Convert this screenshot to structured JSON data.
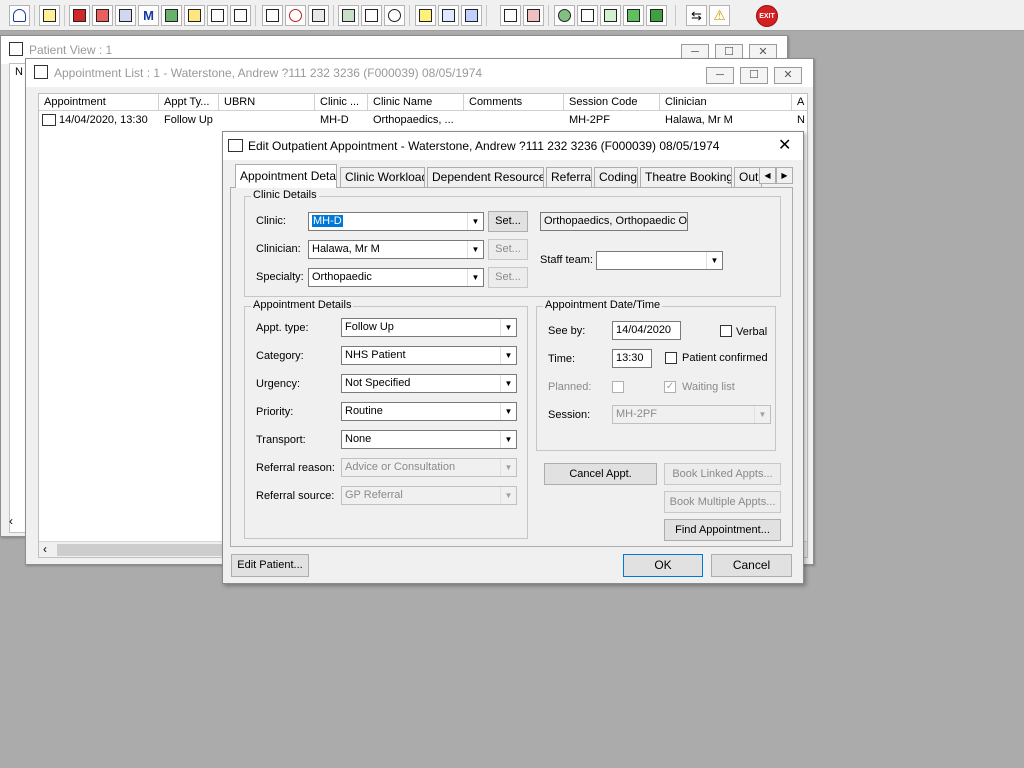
{
  "toolbar": {
    "exit_label": "EXIT"
  },
  "patient_view": {
    "title": "Patient View : 1",
    "col_fragment": "N"
  },
  "appointment_list": {
    "title": "Appointment List : 1 - Waterstone, Andrew ?111 232 3236 (F000039) 08/05/1974",
    "columns": [
      "Appointment",
      "Appt Ty...",
      "UBRN",
      "Clinic ...",
      "Clinic Name",
      "Comments",
      "Session Code",
      "Clinician",
      "A"
    ],
    "rows": [
      {
        "appointment": "14/04/2020, 13:30",
        "appt_type": "Follow Up",
        "ubrn": "",
        "clinic": "MH-D",
        "clinic_name": "Orthopaedics, ...",
        "comments": "",
        "session_code": "MH-2PF",
        "clinician": "Halawa, Mr M",
        "a": "N"
      }
    ]
  },
  "dialog": {
    "title": "Edit Outpatient Appointment - Waterstone, Andrew ?111 232 3236 (F000039) 08/05/1974",
    "tabs": [
      "Appointment Details",
      "Clinic Workload",
      "Dependent Resources",
      "Referral",
      "Coding",
      "Theatre Bookings",
      "Out"
    ],
    "clinic_details": {
      "group_label": "Clinic Details",
      "clinic_label": "Clinic:",
      "clinic_value": "MH-D",
      "clinic_name": "Orthopaedics, Orthopaedic OP",
      "clinician_label": "Clinician:",
      "clinician_value": "Halawa, Mr M",
      "specialty_label": "Specialty:",
      "specialty_value": "Orthopaedic",
      "staff_team_label": "Staff team:",
      "staff_team_value": "",
      "set_label": "Set..."
    },
    "appointment_details": {
      "group_label": "Appointment Details",
      "appt_type_label": "Appt. type:",
      "appt_type_value": "Follow Up",
      "category_label": "Category:",
      "category_value": "NHS Patient",
      "urgency_label": "Urgency:",
      "urgency_value": "Not Specified",
      "priority_label": "Priority:",
      "priority_value": "Routine",
      "transport_label": "Transport:",
      "transport_value": "None",
      "referral_reason_label": "Referral reason:",
      "referral_reason_value": "Advice or Consultation",
      "referral_source_label": "Referral source:",
      "referral_source_value": "GP Referral"
    },
    "datetime": {
      "group_label": "Appointment Date/Time",
      "see_by_label": "See by:",
      "see_by_value": "14/04/2020",
      "verbal_label": "Verbal",
      "time_label": "Time:",
      "time_value": "13:30",
      "patient_confirmed_label": "Patient confirmed",
      "planned_label": "Planned:",
      "waiting_list_label": "Waiting list",
      "session_label": "Session:",
      "session_value": "MH-2PF"
    },
    "buttons": {
      "cancel_appt": "Cancel Appt.",
      "book_linked": "Book Linked Appts...",
      "book_multiple": "Book Multiple Appts...",
      "find_appointment": "Find Appointment...",
      "edit_patient": "Edit Patient...",
      "ok": "OK",
      "cancel": "Cancel"
    }
  }
}
